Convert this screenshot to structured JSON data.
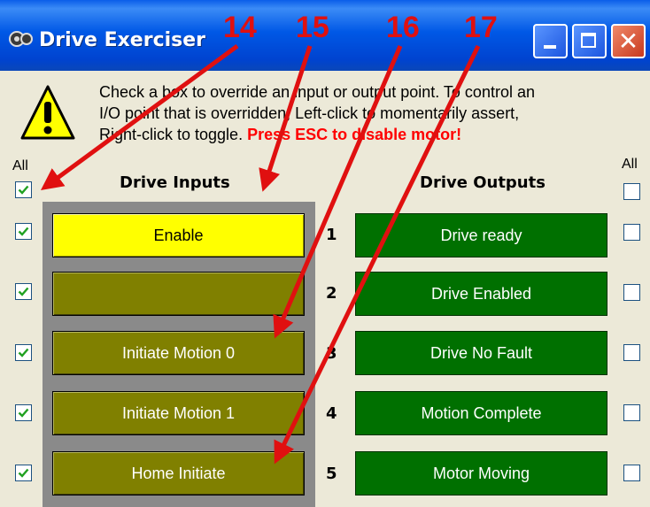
{
  "window": {
    "title": "Drive Exerciser"
  },
  "instructions": {
    "line1": "Check a box to override an input or output point. To control an",
    "line2": "I/O point that is overridden, Left-click to momentarily assert,",
    "line3": "Right-click to toggle.",
    "warning": "Press ESC to disable motor!"
  },
  "labels": {
    "all_left": "All",
    "all_right": "All",
    "inputs_header": "Drive Inputs",
    "outputs_header": "Drive Outputs"
  },
  "checkboxes": {
    "all_inputs_checked": true,
    "all_outputs_checked": false
  },
  "rows": [
    {
      "number": "1",
      "input": "Enable",
      "input_state": "asserted",
      "input_checked": true,
      "output": "Drive ready",
      "output_checked": false
    },
    {
      "number": "2",
      "input": "",
      "input_state": "off",
      "input_checked": true,
      "output": "Drive Enabled",
      "output_checked": false
    },
    {
      "number": "3",
      "input": "Initiate Motion 0",
      "input_state": "off",
      "input_checked": true,
      "output": "Drive No Fault",
      "output_checked": false
    },
    {
      "number": "4",
      "input": "Initiate Motion 1",
      "input_state": "off",
      "input_checked": true,
      "output": "Motion Complete",
      "output_checked": false
    },
    {
      "number": "5",
      "input": "Home Initiate",
      "input_state": "off",
      "input_checked": true,
      "output": "Motor Moving",
      "output_checked": false
    }
  ],
  "callouts": [
    "14",
    "15",
    "16",
    "17"
  ],
  "colors": {
    "input_asserted": "#ffff00",
    "input_off": "#808000",
    "output": "#007000",
    "callout_red": "#e01010",
    "warning_red": "#ff0000"
  },
  "icons": {
    "app": "drive-app-icon",
    "warning": "warning-triangle-icon",
    "minimize": "minimize-icon",
    "maximize": "maximize-icon",
    "close": "close-icon",
    "check": "checkmark-icon"
  }
}
